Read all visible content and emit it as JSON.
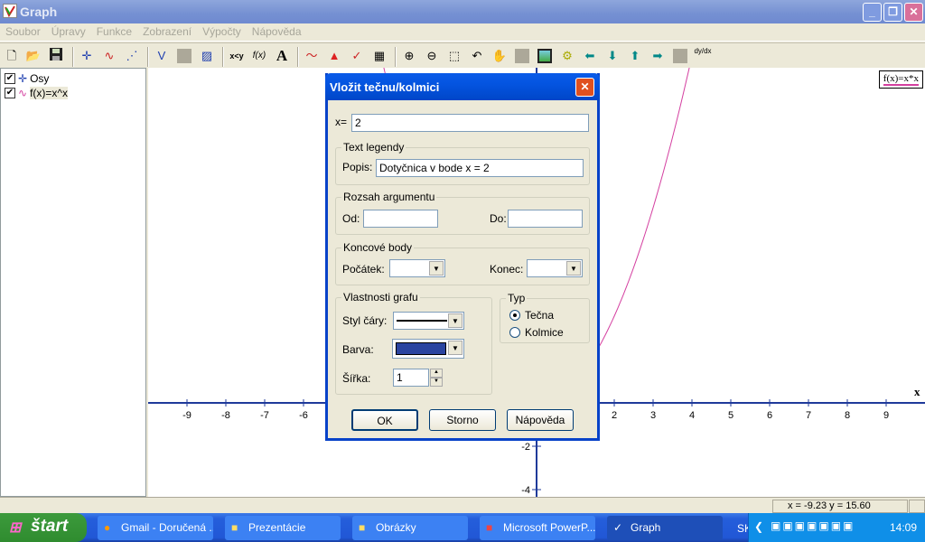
{
  "window": {
    "title": "Graph",
    "minimize": "_",
    "restore": "❐",
    "close": "✕"
  },
  "menu": [
    "Soubor",
    "Úpravy",
    "Funkce",
    "Zobrazení",
    "Výpočty",
    "Nápověda"
  ],
  "toolbar": {
    "icons": [
      "new-file",
      "open-folder",
      "save-disk",
      "axes",
      "insert-function",
      "point-series",
      "tangent",
      "shading-disabled",
      "shading",
      "relation",
      "insert-function-fx",
      "text",
      "trendline",
      "area",
      "tangent-normal",
      "table",
      "zoom-in",
      "zoom-out",
      "zoom-window",
      "undo-zoom",
      "hand-pan",
      "disabled-square",
      "image",
      "animate",
      "arrow-left",
      "arrow-down",
      "arrow-up",
      "arrow-right",
      "evaluate-disabled",
      "derivative"
    ],
    "labels": {
      "relation": "x<y",
      "insert-function-fx": "f(x)",
      "text": "A",
      "derivative": "dy/dx"
    }
  },
  "tree": [
    {
      "label": "Osy",
      "checked": true
    },
    {
      "label": "f(x)=x^x",
      "checked": true
    }
  ],
  "legend": {
    "label": "f(x)=x*x",
    "color": "#d43fa0"
  },
  "graph": {
    "x_label": "x",
    "x_ticks": [
      -9,
      -8,
      -7,
      -6,
      2,
      3,
      4,
      5,
      6,
      7,
      8,
      9
    ],
    "y_ticks": [
      -2,
      -4
    ],
    "function": "x*x",
    "curve_color": "#d43fa0",
    "axis_color": "#1f3a9a"
  },
  "dialog": {
    "title": "Vložit tečnu/kolmici",
    "x_label": "x=",
    "x_value": "2",
    "legend_group": "Text legendy",
    "popis_label": "Popis:",
    "popis_value": "Dotyčnica v bode x = 2",
    "range_group": "Rozsah argumentu",
    "od_label": "Od:",
    "od_value": "",
    "do_label": "Do:",
    "do_value": "",
    "endpoints_group": "Koncové body",
    "start_label": "Počátek:",
    "start_value": "",
    "end_label": "Konec:",
    "end_value": "",
    "props_group": "Vlastnosti grafu",
    "style_label": "Styl čáry:",
    "color_label": "Barva:",
    "color_value": "#2a44a0",
    "width_label": "Šířka:",
    "width_value": "1",
    "type_group": "Typ",
    "type_options": [
      "Tečna",
      "Kolmice"
    ],
    "type_selected": "Tečna",
    "ok": "OK",
    "cancel": "Storno",
    "help": "Nápověda"
  },
  "status": {
    "coords": "x = -9.23   y = 15.60"
  },
  "taskbar": {
    "start": "štart",
    "tasks": [
      "Gmail - Doručená ...",
      "Prezentácie",
      "Obrázky",
      "Microsoft PowerP...",
      "Graph"
    ],
    "active": "Graph",
    "lang": "SK",
    "clock": "14:09"
  }
}
